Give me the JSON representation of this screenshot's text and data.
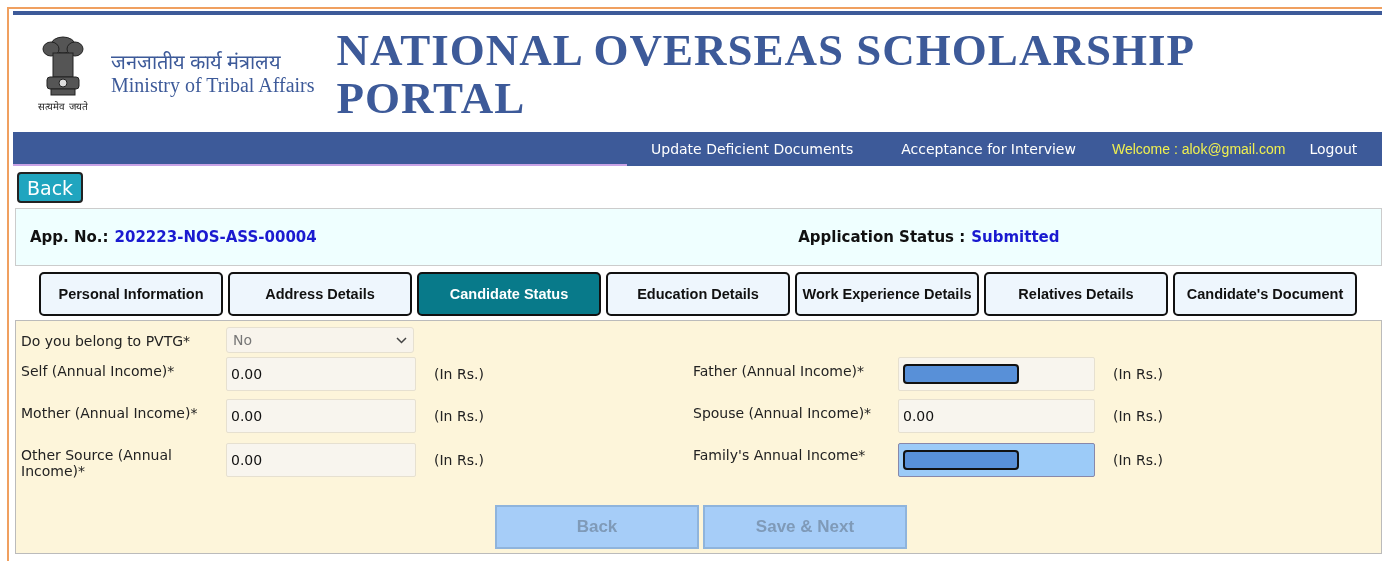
{
  "header": {
    "emblem_motto": "सत्यमेव जयते",
    "ministry_hindi": "जनजातीय कार्य मंत्रालय",
    "ministry_english": "Ministry of Tribal Affairs",
    "title_line_1": "NATIONAL OVERSEAS SCHOLARSHIP",
    "title_line_2": "PORTAL"
  },
  "nav": {
    "links": [
      "Update Deficient Documents",
      "Acceptance for Interview"
    ],
    "welcome": "Welcome : alok@gmail.com",
    "logout": "Logout"
  },
  "back_button": "Back",
  "application": {
    "number_label": "App. No.:",
    "number": "202223-NOS-ASS-00004",
    "status_label": "Application Status :",
    "status": "Submitted"
  },
  "tabs": [
    {
      "label": "Personal Information",
      "selected": false
    },
    {
      "label": "Address Details",
      "selected": false
    },
    {
      "label": "Candidate Status",
      "selected": true
    },
    {
      "label": "Education Details",
      "selected": false
    },
    {
      "label": "Work Experience Details",
      "selected": false
    },
    {
      "label": "Relatives Details",
      "selected": false
    },
    {
      "label": "Candidate's Document",
      "selected": false
    }
  ],
  "form": {
    "rows": [
      {
        "fields": [
          {
            "kind": "select",
            "label": "Do you belong to PVTG*",
            "value": "No"
          }
        ]
      },
      {
        "fields": [
          {
            "kind": "input",
            "label": "Self (Annual Income)*",
            "value": "0.00",
            "unit": "(In Rs.)",
            "redacted": false,
            "highlighted": false
          },
          {
            "kind": "input",
            "label": "Father (Annual Income)*",
            "unit": "(In Rs.)",
            "redacted": true,
            "highlighted": false
          }
        ]
      },
      {
        "fields": [
          {
            "kind": "input",
            "label": "Mother (Annual Income)*",
            "value": "0.00",
            "unit": "(In Rs.)",
            "redacted": false,
            "highlighted": false
          },
          {
            "kind": "input",
            "label": "Spouse (Annual Income)*",
            "value": "0.00",
            "unit": "(In Rs.)",
            "redacted": false,
            "highlighted": false
          }
        ]
      },
      {
        "fields": [
          {
            "kind": "input",
            "label": "Other Source (Annual Income)*",
            "value": "0.00",
            "unit": "(In Rs.)",
            "redacted": false,
            "highlighted": false
          },
          {
            "kind": "input",
            "label": "Family's Annual Income*",
            "unit": "(In Rs.)",
            "redacted": true,
            "highlighted": true
          }
        ]
      }
    ],
    "buttons": [
      {
        "label": "Back",
        "disabled": true
      },
      {
        "label": "Save & Next",
        "disabled": true
      }
    ]
  }
}
